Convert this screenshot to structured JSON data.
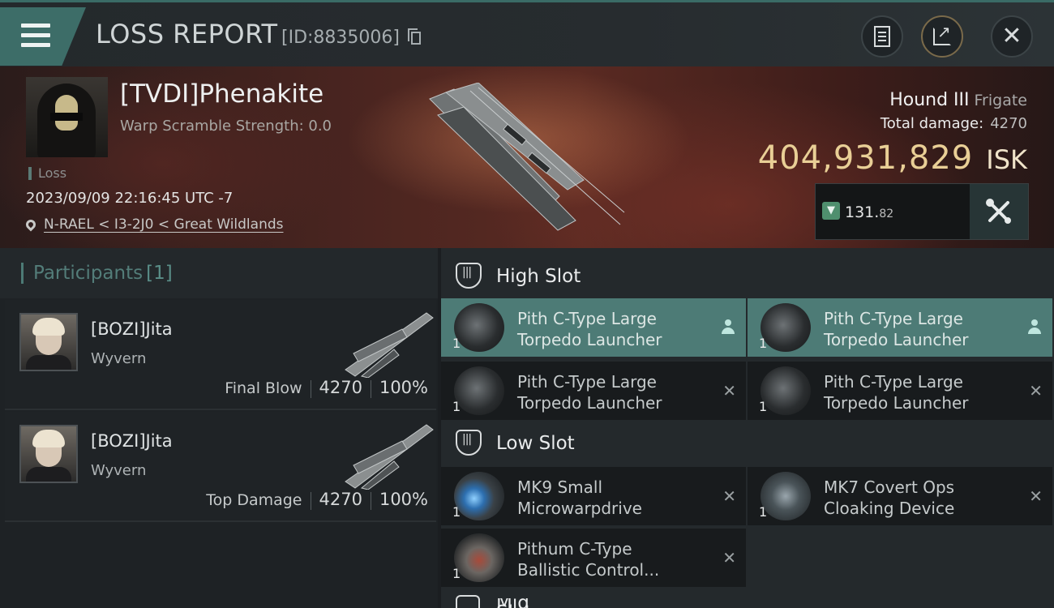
{
  "header": {
    "title": "LOSS REPORT",
    "report_id": "[ID:8835006]"
  },
  "victim": {
    "name": "[TVDI]Phenakite",
    "warp_scramble": "Warp Scramble Strength: 0.0",
    "loss_label": "Loss",
    "time": "2023/09/09 22:16:45 UTC -7",
    "location": "N-RAEL < I3-2J0 < Great Wildlands",
    "ship_name": "Hound III",
    "ship_class": "Frigate",
    "total_damage_label": "Total damage:",
    "total_damage": "4270",
    "isk_value": "404,931,829",
    "isk_unit": "ISK",
    "fitting_value_main": "131.",
    "fitting_value_decimal": "82"
  },
  "participants": {
    "title": "Participants",
    "count": "[1]",
    "rows": [
      {
        "name": "[BOZI]Jita",
        "ship": "Wyvern",
        "role": "Final Blow",
        "damage": "4270",
        "percent": "100%"
      },
      {
        "name": "[BOZI]Jita",
        "ship": "Wyvern",
        "role": "Top Damage",
        "damage": "4270",
        "percent": "100%"
      }
    ]
  },
  "slots": {
    "high": {
      "label": "High Slot",
      "modules": [
        {
          "name_line1": "Pith C-Type Large",
          "name_line2": "Torpedo Launcher",
          "qty": "1",
          "status": "dropped"
        },
        {
          "name_line1": "Pith C-Type Large",
          "name_line2": "Torpedo Launcher",
          "qty": "1",
          "status": "dropped"
        },
        {
          "name_line1": "Pith C-Type Large",
          "name_line2": "Torpedo Launcher",
          "qty": "1",
          "status": "destroyed"
        },
        {
          "name_line1": "Pith C-Type Large",
          "name_line2": "Torpedo Launcher",
          "qty": "1",
          "status": "destroyed"
        }
      ]
    },
    "low": {
      "label": "Low Slot",
      "modules": [
        {
          "name_line1": "MK9 Small",
          "name_line2": "Microwarpdrive",
          "qty": "1",
          "status": "destroyed"
        },
        {
          "name_line1": "MK7 Covert Ops",
          "name_line2": "Cloaking Device",
          "qty": "1",
          "status": "destroyed"
        },
        {
          "name_line1": "Pithum C-Type",
          "name_line2": "Ballistic Control...",
          "qty": "1",
          "status": "destroyed"
        }
      ]
    },
    "next_header_partial": "Mid Slot"
  },
  "colors": {
    "accent": "#4d7b76",
    "isk_gold": "#e9cf96",
    "banner_red": "#5a2a22"
  },
  "icons": [
    "menu-icon",
    "copy-icon",
    "notes-icon",
    "share-icon",
    "close-icon",
    "location-pin-icon",
    "fitting-shield-icon",
    "tools-icon",
    "slot-icon",
    "person-icon",
    "x-icon"
  ]
}
